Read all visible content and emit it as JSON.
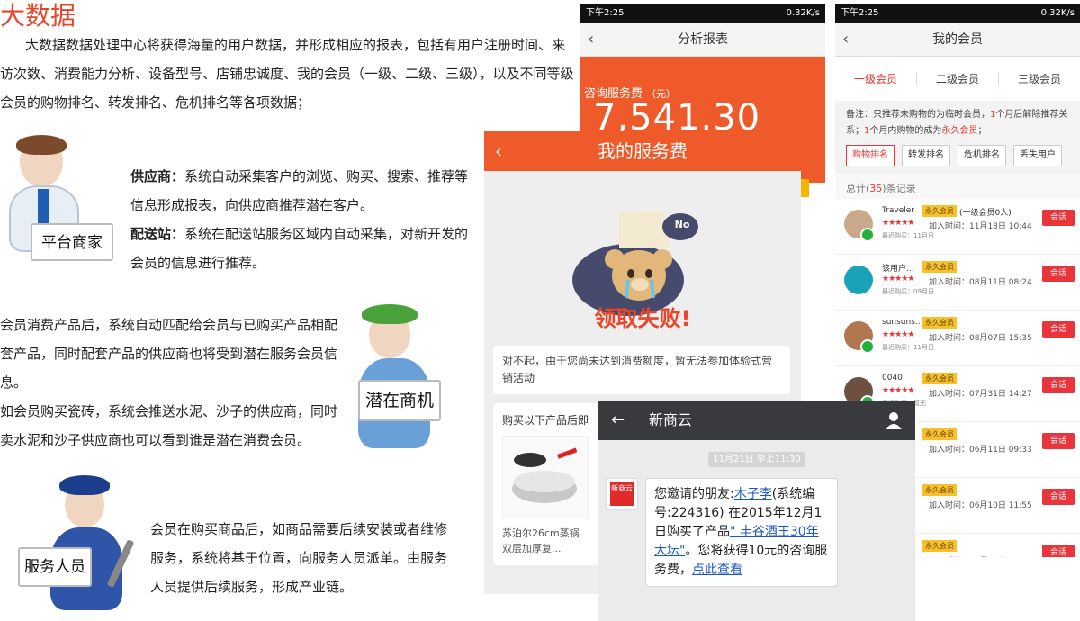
{
  "article": {
    "title": "大数据",
    "intro": "大数据数据处理中心将获得海量的用户数据，并形成相应的报表，包括有用户注册时间、来访次数、消费能力分析、设备型号、店铺忠诚度、我的会员（一级、二级、三级），以及不同等级会员的购物排名、转发排名、危机排名等各项数据；",
    "supplier_label": "供应商：",
    "supplier_text": "系统自动采集客户的浏览、购买、搜索、推荐等信息形成报表，向供应商推荐潜在客户。",
    "delivery_label": "配送站：",
    "delivery_text": "系统在配送站服务区域内自动采集，对新开发的会员的信息进行推荐。",
    "opportunity_text_1": "会员消费产品后，系统自动匹配给会员与已购买产品相配套产品，同时配套产品的供应商也将受到潜在服务会员信息。",
    "opportunity_text_2": "如会员购买瓷砖，系统会推送水泥、沙子的供应商，同时卖水泥和沙子供应商也可以看到谁是潜在消费会员。",
    "service_text": "会员在购买商品后，如商品需要后续安装或者维修服务，系统将基于位置，向服务人员派单。由服务人员提供后续服务，形成产业链。",
    "figures": {
      "merchant_sign": "平台商家",
      "opportunity_sign": "潜在商机",
      "service_sign": "服务人员"
    }
  },
  "status_bar": {
    "time": "下午2:25",
    "speed": "0.32K/s"
  },
  "report_screen": {
    "title": "分析报表",
    "label": "咨询服务费",
    "unit": "（元）",
    "amount": "7,541.30"
  },
  "fee_screen": {
    "title": "我的服务费",
    "fail_text": "领取失败!",
    "bubble_text": "No",
    "message": "对不起，由于您尚未达到消费额度，暂无法参加体验式营销活动",
    "products_title": "购买以下产品后即",
    "product_name": "苏泊尔26cm蒸锅双层加厚复..."
  },
  "members_screen": {
    "title": "我的会员",
    "tabs": [
      "一级会员",
      "二级会员",
      "三级会员"
    ],
    "note_1": "备注：只推荐未购物的为临时会员，",
    "note_1_num": "1",
    "note_2": "个月后解除推荐关系；",
    "note_3_num": "1",
    "note_3": "个月内购物的成为",
    "note_permanent": "永久会员",
    "note_end": "；",
    "rank_tabs": [
      "购物排名",
      "转发排名",
      "危机排名",
      "丢失用户"
    ],
    "total_prefix": "总计(",
    "total_count": "35",
    "total_suffix": ")条记录",
    "chat_label": "会话",
    "badge": "永久会员",
    "stars": "★★★★★",
    "rows": [
      {
        "name": "Traveler",
        "level": "(一级会员0人)",
        "join": "加入时间：11月18日 10:44",
        "last": "最近购买：11月日",
        "avatar_color": "#c9a98c"
      },
      {
        "name": "该用户...",
        "level": "",
        "join": "加入时间：08月11日 08:24",
        "last": "最近购买：09月日",
        "avatar_color": "#1aa3b8"
      },
      {
        "name": "sunsuns..",
        "level": "",
        "join": "加入时间：08月07日 15:35",
        "last": "最近购买：11月日",
        "avatar_color": "#b07850"
      },
      {
        "name": "0040",
        "level": "",
        "join": "加入时间：07月31日 14:27",
        "last": "最近购买：暂无",
        "avatar_color": "#6c5040"
      },
      {
        "name": "",
        "level": "",
        "join": "加入时间：06月11日 09:33",
        "last": "",
        "avatar_color": "#dddddd"
      },
      {
        "name": "",
        "level": "",
        "join": "加入时间：06月10日 11:55",
        "last": "",
        "avatar_color": "#dddddd"
      },
      {
        "name": "",
        "level": "",
        "join": "加入时间：06月10日 09:00",
        "last": "",
        "avatar_color": "#dddddd"
      }
    ]
  },
  "wechat_screen": {
    "title": "新商云",
    "timestamp": "11月21日 早上11:30",
    "msg_1": "您邀请的朋友:",
    "msg_friend": "木子李",
    "msg_2": "(系统编号:224316) 在2015年12月1日购买了产品",
    "msg_product": "\" 丰谷酒王30年大坛\"",
    "msg_3": "。您将获得10元的咨询服务费，",
    "msg_link": "点此查看",
    "avatar_text": "新商云"
  },
  "colors": {
    "accent": "#ee5a2a",
    "title_red": "#e8452a",
    "chat_red": "#e8343a",
    "badge_yellow": "#f7c12b",
    "wechat_header": "#393a3e"
  }
}
